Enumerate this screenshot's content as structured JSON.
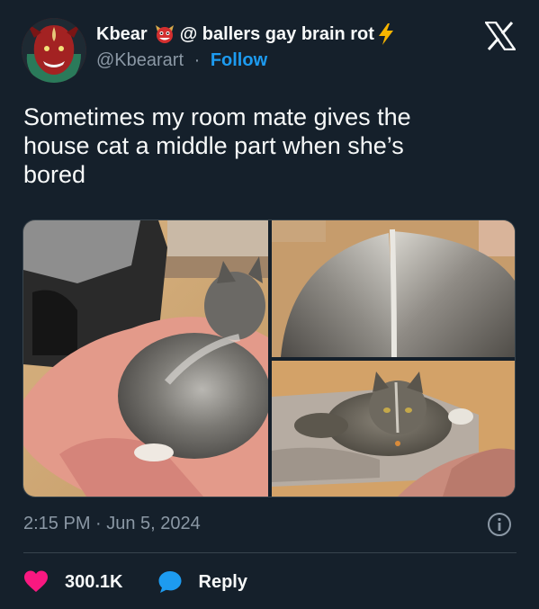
{
  "author": {
    "display_name_part1": "Kbear",
    "display_name_part2": "@ ballers gay brain rot",
    "handle": "@Kbearart",
    "separator": "·",
    "follow_label": "Follow"
  },
  "icons": {
    "avatar": "devil-avatar",
    "name_emoji": "ogre-mask-emoji",
    "name_bolt": "lightning-bolt-emoji",
    "logo": "x-logo-icon",
    "info": "info-icon",
    "like": "heart-icon",
    "reply": "speech-bubble-icon"
  },
  "tweet": {
    "text_line1": "Sometimes my room mate gives the",
    "text_line2": "house cat a middle part when she’s",
    "text_line3": "bored"
  },
  "media": {
    "photos": [
      "cat-back-on-blanket",
      "cat-fur-middle-part-closeup",
      "cat-lying-on-rug"
    ]
  },
  "meta": {
    "timestamp": "2:15 PM · Jun 5, 2024"
  },
  "actions": {
    "likes_count": "300.1K",
    "reply_label": "Reply"
  },
  "colors": {
    "background": "#15202b",
    "text": "#f7f9f9",
    "secondary_text": "#8b98a5",
    "accent": "#1d9bf0",
    "like": "#f91880"
  }
}
